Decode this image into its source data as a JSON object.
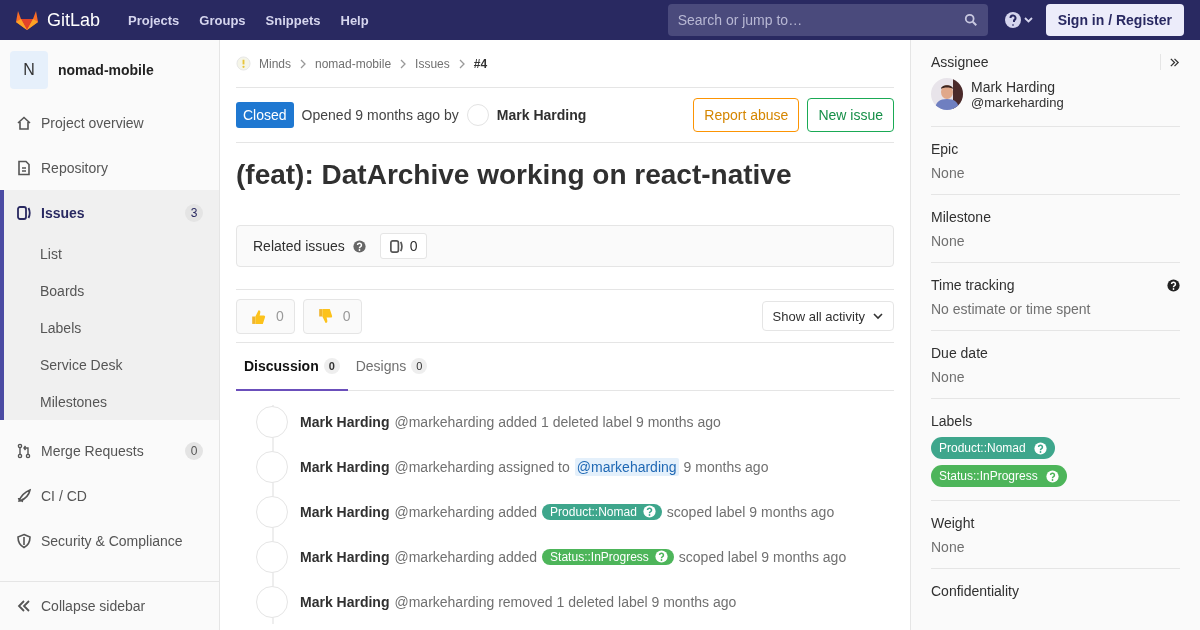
{
  "topbar": {
    "brand": "GitLab",
    "nav": [
      {
        "label": "Projects"
      },
      {
        "label": "Groups"
      },
      {
        "label": "Snippets"
      },
      {
        "label": "Help"
      }
    ],
    "search": {
      "placeholder": "Search or jump to…"
    },
    "sign_in": "Sign in / Register"
  },
  "sidebar": {
    "project_initial": "N",
    "project_name": "nomad-mobile",
    "items": [
      {
        "label": "Project overview",
        "kind": "home",
        "selected": false
      },
      {
        "label": "Repository",
        "kind": "doc",
        "selected": false
      },
      {
        "label": "Issues",
        "kind": "issues",
        "selected": true,
        "count": "3",
        "children": [
          {
            "label": "List"
          },
          {
            "label": "Boards"
          },
          {
            "label": "Labels"
          },
          {
            "label": "Service Desk"
          },
          {
            "label": "Milestones"
          }
        ]
      },
      {
        "label": "Merge Requests",
        "kind": "merge",
        "selected": false,
        "count": "0"
      },
      {
        "label": "CI / CD",
        "kind": "rocket",
        "selected": false
      },
      {
        "label": "Security & Compliance",
        "kind": "shield",
        "selected": false
      }
    ],
    "collapse": "Collapse sidebar"
  },
  "breadcrumbs": [
    "Minds",
    "nomad-mobile",
    "Issues",
    "#4"
  ],
  "issue": {
    "status": "Closed",
    "opened": "Opened 9 months ago by",
    "author": "Mark Harding",
    "buttons": [
      {
        "label": "Report abuse",
        "kind": "warning"
      },
      {
        "label": "New issue",
        "kind": "success"
      }
    ],
    "title": "(feat): DatArchive working on react-native",
    "related": {
      "label": "Related issues",
      "count": "0"
    },
    "reactions": [
      {
        "kind": "thumbsup",
        "count": "0"
      },
      {
        "kind": "thumbsdown",
        "count": "0"
      }
    ],
    "filter": "Show all activity",
    "tabs": [
      {
        "label": "Discussion",
        "count": "0",
        "selected": true
      },
      {
        "label": "Designs",
        "count": "0",
        "selected": false
      }
    ],
    "events": [
      {
        "author": "Mark Harding",
        "parts": [
          {
            "kind": "text",
            "text": "@markeharding added 1 deleted label 9 months ago"
          }
        ]
      },
      {
        "author": "Mark Harding",
        "parts": [
          {
            "kind": "text",
            "text": "@markeharding assigned to"
          },
          {
            "kind": "mention",
            "text": "@markeharding"
          },
          {
            "kind": "text",
            "text": "9 months ago"
          }
        ]
      },
      {
        "author": "Mark Harding",
        "parts": [
          {
            "kind": "text",
            "text": "@markeharding added"
          },
          {
            "kind": "label",
            "text": "Product::Nomad",
            "color": "#3ea68c"
          },
          {
            "kind": "text",
            "text": "scoped label 9 months ago"
          }
        ]
      },
      {
        "author": "Mark Harding",
        "parts": [
          {
            "kind": "text",
            "text": "@markeharding added"
          },
          {
            "kind": "label",
            "text": "Status::InProgress",
            "color": "#4db55a"
          },
          {
            "kind": "text",
            "text": "scoped label 9 months ago"
          }
        ]
      },
      {
        "author": "Mark Harding",
        "parts": [
          {
            "kind": "text",
            "text": "@markeharding removed 1 deleted label 9 months ago"
          }
        ]
      }
    ]
  },
  "right_sidebar": {
    "assignee": {
      "heading": "Assignee",
      "name": "Mark Harding",
      "handle": "@markeharding"
    },
    "sections": [
      {
        "heading": "Epic",
        "value": "None"
      },
      {
        "heading": "Milestone",
        "value": "None"
      },
      {
        "heading": "Time tracking",
        "value": "No estimate or time spent",
        "help": true
      },
      {
        "heading": "Due date",
        "value": "None"
      },
      {
        "heading": "Labels",
        "labels": [
          {
            "text": "Product::Nomad",
            "color": "#3ea68c"
          },
          {
            "text": "Status::InProgress",
            "color": "#4db55a"
          }
        ]
      },
      {
        "heading": "Weight",
        "value": "None"
      },
      {
        "heading": "Confidentiality"
      }
    ]
  }
}
